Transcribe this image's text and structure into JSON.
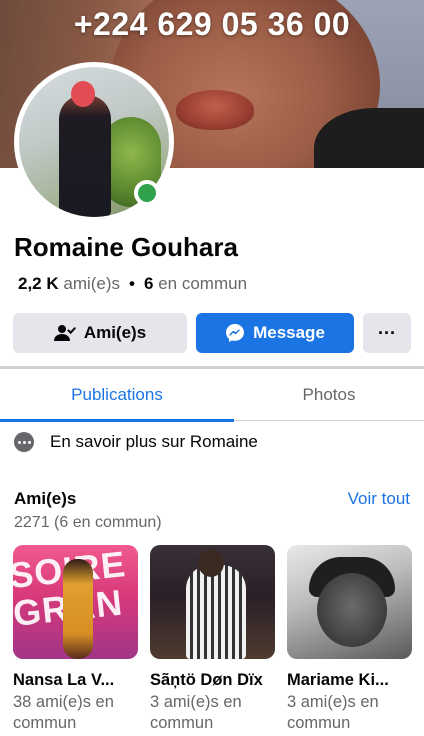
{
  "cover": {
    "phone_text": "+224 629 05 36 00"
  },
  "profile": {
    "name": "Romaine Gouhara",
    "friends_count": "2,2 K",
    "friends_label": "ami(e)s",
    "separator": "•",
    "mutual_count": "6",
    "mutual_label": "en commun",
    "online": true,
    "online_color": "#31a24c"
  },
  "actions": {
    "friends_label": "Ami(e)s",
    "message_label": "Message",
    "more_label": "···"
  },
  "tabs": [
    {
      "label": "Publications",
      "active": true
    },
    {
      "label": "Photos",
      "active": false
    }
  ],
  "about": {
    "label": "En savoir plus sur Romaine"
  },
  "friends_section": {
    "title": "Ami(e)s",
    "see_all": "Voir tout",
    "count": "2271 (6 en commun)",
    "items": [
      {
        "name": "Nansa La V...",
        "mutual": "38 ami(e)s en commun"
      },
      {
        "name": "Sãņtö Døn Dïx",
        "mutual": "3 ami(e)s en commun"
      },
      {
        "name": "Mariame Ki...",
        "mutual": "3 ami(e)s en commun"
      }
    ]
  },
  "colors": {
    "accent": "#1b74e4",
    "button_secondary": "#e4e6eb",
    "secondary_text": "#65676b"
  }
}
